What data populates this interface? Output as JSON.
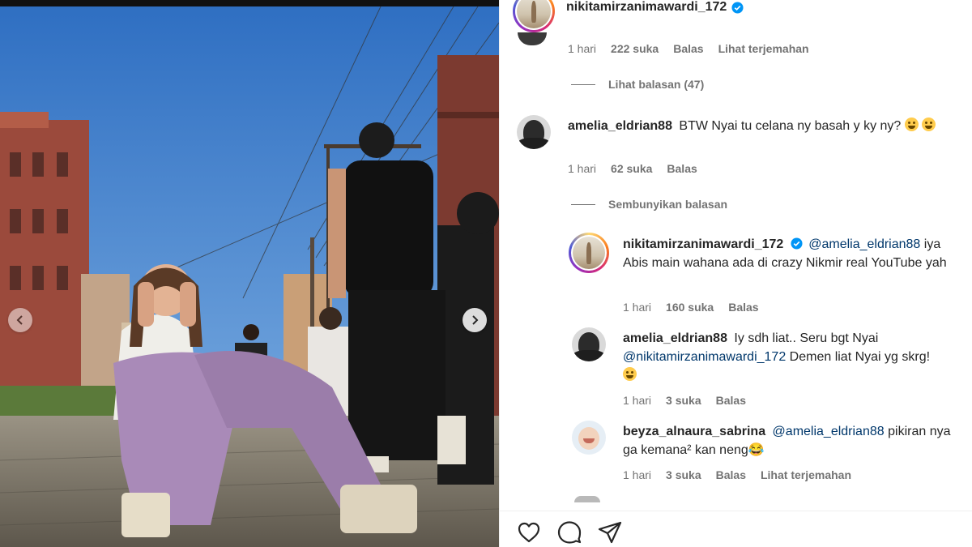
{
  "post": {
    "author": "nikitamirzanimawardi_172"
  },
  "comments": [
    {
      "meta": {
        "time": "1 hari",
        "likes": "222 suka",
        "reply": "Balas",
        "translate": "Lihat terjemahan"
      },
      "replies_toggle": "Lihat balasan (47)"
    },
    {
      "username": "amelia_eldrian88",
      "text": "BTW Nyai tu celana ny basah y ky ny?",
      "meta": {
        "time": "1 hari",
        "likes": "62 suka",
        "reply": "Balas"
      },
      "replies_toggle": "Sembunyikan balasan",
      "replies": [
        {
          "username": "nikitamirzanimawardi_172",
          "mention": "@amelia_eldrian88",
          "text": "iya Abis main wahana ada di crazy Nikmir real YouTube yah",
          "meta": {
            "time": "1 hari",
            "likes": "160 suka",
            "reply": "Balas"
          }
        },
        {
          "username": "amelia_eldrian88",
          "text_before": "Iy sdh liat.. Seru bgt Nyai",
          "mention": "@nikitamirzanimawardi_172",
          "text_after": "Demen liat Nyai yg skrg!",
          "meta": {
            "time": "1 hari",
            "likes": "3 suka",
            "reply": "Balas"
          }
        },
        {
          "username": "beyza_alnaura_sabrina",
          "mention": "@amelia_eldrian88",
          "text": "pikiran nya ga kemana² kan neng😂",
          "meta": {
            "time": "1 hari",
            "likes": "3 suka",
            "reply": "Balas",
            "translate": "Lihat terjemahan"
          }
        }
      ]
    }
  ],
  "actions": {
    "like_icon": "heart-icon",
    "comment_icon": "comment-icon",
    "share_icon": "send-icon"
  },
  "colors": {
    "text": "#262626",
    "secondary": "#737373",
    "mention": "#00376b",
    "verified": "#0095f6",
    "sky": "#3f7fd0"
  }
}
